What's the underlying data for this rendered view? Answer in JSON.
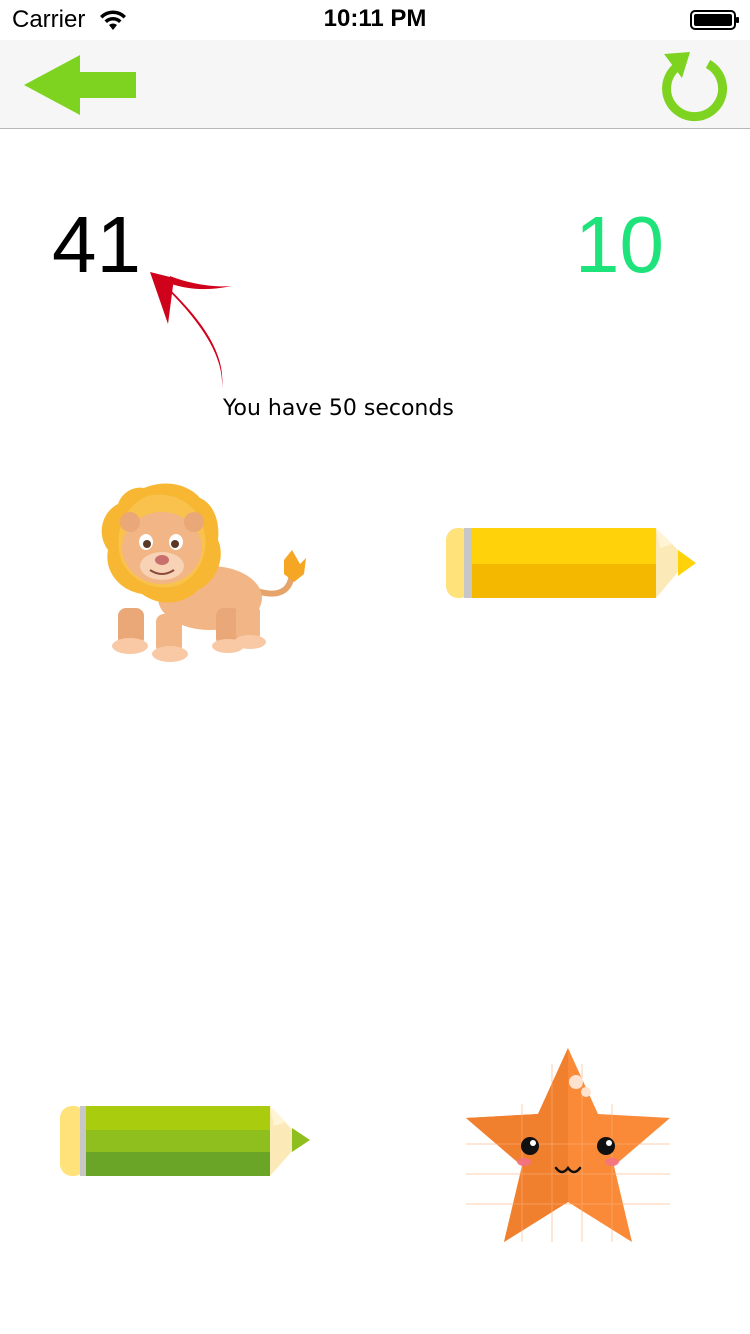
{
  "status_bar": {
    "carrier": "Carrier",
    "time": "10:11 PM",
    "wifi_icon": "wifi-icon",
    "battery_icon": "battery-full-icon"
  },
  "nav_bar": {
    "back_icon": "green-left-arrow-icon",
    "refresh_icon": "green-refresh-icon"
  },
  "game": {
    "left_counter": "41",
    "right_counter": "10",
    "hint": "You have 50 seconds",
    "items": [
      {
        "name": "lion",
        "icon": "lion-icon"
      },
      {
        "name": "yellow-pencil",
        "icon": "yellow-pencil-icon"
      },
      {
        "name": "green-pencil",
        "icon": "green-pencil-icon"
      },
      {
        "name": "star",
        "icon": "orange-star-icon"
      }
    ]
  },
  "colors": {
    "accent_green": "#7ed321",
    "counter_green": "#1de37a",
    "hint_arrow_red": "#d0021b",
    "nav_background": "#f6f6f6"
  }
}
